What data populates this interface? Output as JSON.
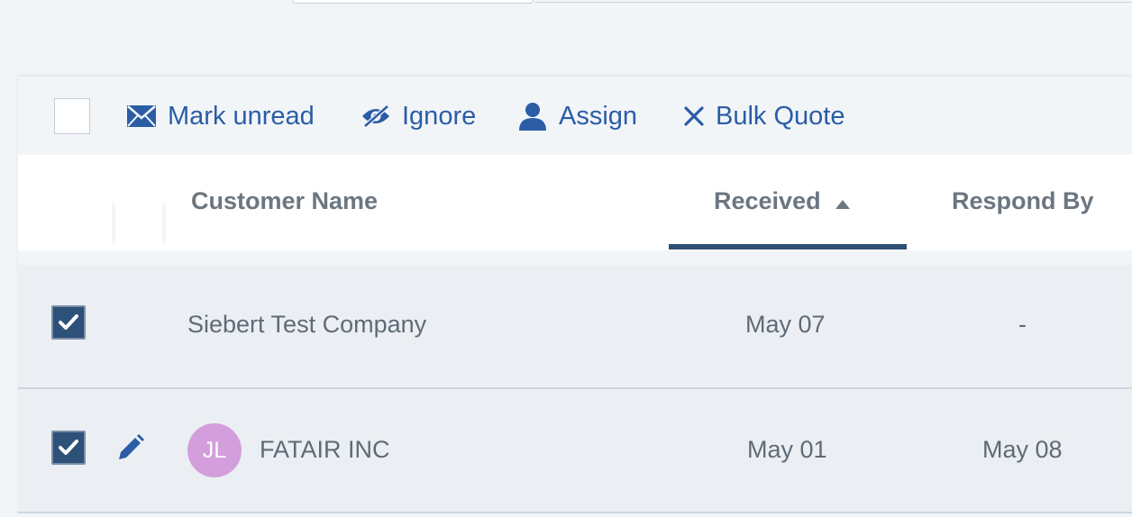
{
  "toolbar": {
    "actions": [
      {
        "label": "Mark unread",
        "icon": "envelope-icon"
      },
      {
        "label": "Ignore",
        "icon": "eye-slash-icon"
      },
      {
        "label": "Assign",
        "icon": "user-icon"
      },
      {
        "label": "Bulk Quote",
        "icon": "close-icon"
      }
    ]
  },
  "table": {
    "columns": [
      "Customer Name",
      "Received",
      "Respond By"
    ],
    "sorted_column": "Received",
    "sort_direction": "ascending",
    "rows": [
      {
        "selected": true,
        "editable": false,
        "avatar": "",
        "customer": "Siebert Test Company",
        "received": "May 07",
        "respond_by": "-"
      },
      {
        "selected": true,
        "editable": true,
        "avatar": "JL",
        "customer": "FATAIR INC",
        "received": "May 01",
        "respond_by": "May 08"
      }
    ]
  },
  "colors": {
    "accent": "#2b5da6",
    "checkbox": "#2d5179",
    "sort_underline": "#2f4f73",
    "avatar": "#d39edb",
    "row_background": "#ebeff3"
  }
}
